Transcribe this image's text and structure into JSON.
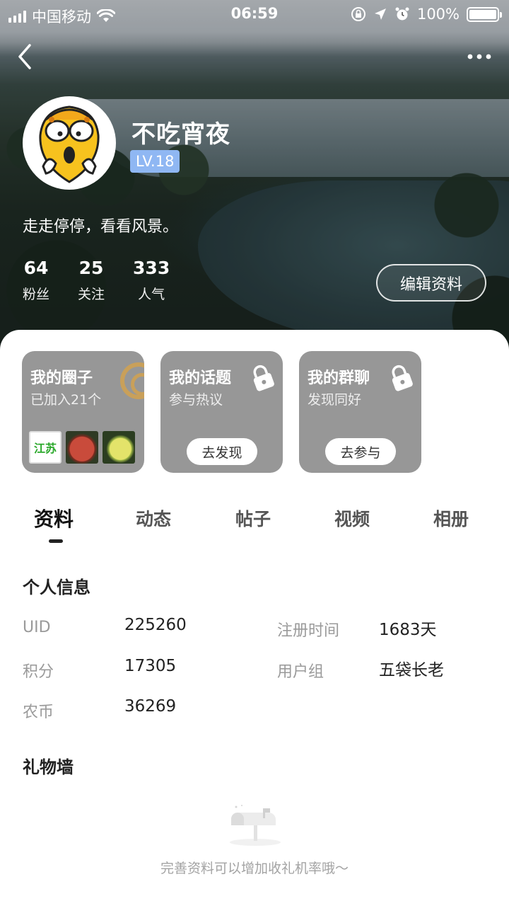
{
  "status_bar": {
    "carrier": "中国移动",
    "time": "06:59",
    "battery": "100%"
  },
  "profile": {
    "name": "不吃宵夜",
    "level": "LV.18",
    "bio": "走走停停，看看风景。",
    "stats": [
      {
        "value": "64",
        "label": "粉丝"
      },
      {
        "value": "25",
        "label": "关注"
      },
      {
        "value": "333",
        "label": "人气"
      }
    ],
    "edit_label": "编辑资料"
  },
  "cards": [
    {
      "title": "我的圈子",
      "sub": "已加入21个",
      "thumb_label": "江苏"
    },
    {
      "title": "我的话题",
      "sub": "参与热议",
      "button": "去发现"
    },
    {
      "title": "我的群聊",
      "sub": "发现同好",
      "button": "去参与"
    }
  ],
  "tabs": [
    "资料",
    "动态",
    "帖子",
    "视频",
    "相册"
  ],
  "active_tab": "资料",
  "info": {
    "title": "个人信息",
    "rows": [
      {
        "label": "UID",
        "value": "225260"
      },
      {
        "label": "积分",
        "value": "17305"
      },
      {
        "label": "农币",
        "value": "36269"
      },
      {
        "label": "注册时间",
        "value": "1683天"
      },
      {
        "label": "用户组",
        "value": "五袋长老"
      }
    ]
  },
  "gifts": {
    "title": "礼物墙",
    "empty_text": "完善资料可以增加收礼机率哦～"
  },
  "colors": {
    "level_badge": "#8fb7f3",
    "card_bg": "#979797"
  }
}
